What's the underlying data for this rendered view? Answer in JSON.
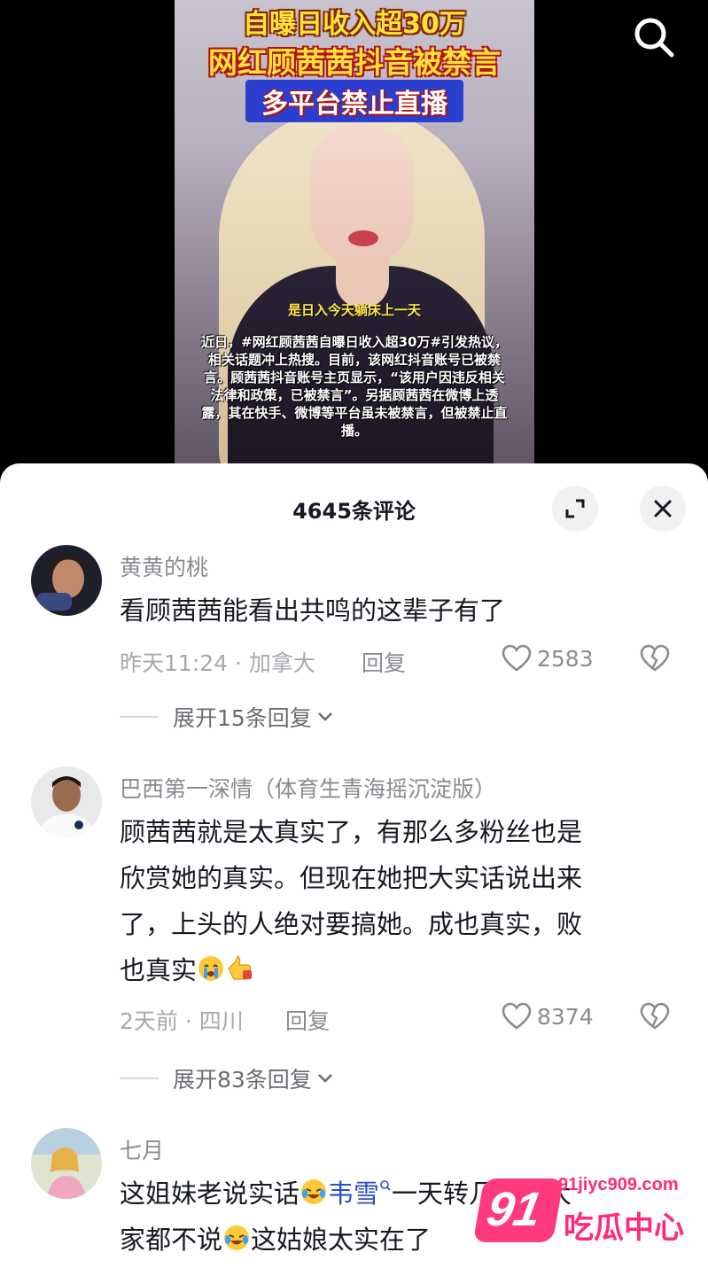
{
  "video": {
    "headline_1": "自曝日收入超30万",
    "headline_2": "网红顾茜茜抖音被禁言",
    "headline_3": "多平台禁止直播",
    "caption": "是日入今天躺床上一天",
    "news_text": "近日，#网红顾茜茜自曝日收入超30万#引发热议，相关话题冲上热搜。目前，该网红抖音账号已被禁言。顾茜茜抖音账号主页显示，“该用户因违反相关法律和政策，已被禁言”。另据顾茜茜在微博上透露，其在快手、微博等平台虽未被禁言，但被禁止直播。"
  },
  "comments_sheet": {
    "title": "4645条评论"
  },
  "comments": [
    {
      "user": "黄黄的桃",
      "text": "看顾茜茜能看出共鸣的这辈子有了",
      "meta": "昨天11:24 · 加拿大",
      "reply_label": "回复",
      "likes": "2583",
      "expand_label": "展开15条回复"
    },
    {
      "user": "巴西第一深情（体育生青海摇沉淀版）",
      "text_line_1": "顾茜茜就是太真实了，有那么多粉丝也是",
      "text_line_2": "欣赏她的真实。但现在她把大实话说出来",
      "text_line_3": "了，上头的人绝对要搞她。成也真实，败",
      "text_line_4": "也真实",
      "meta": "2天前 · 四川",
      "reply_label": "回复",
      "likes": "8374",
      "expand_label": "展开83条回复"
    },
    {
      "user": "七月",
      "text_a": "这姐妹老说实话",
      "mention": "韦雪",
      "text_b": "一天转几百万大",
      "text_c": "家都不说",
      "text_d": "这姑娘太实在了"
    }
  ],
  "watermark": {
    "domain": "91jiyc909.com",
    "logo_number": "91",
    "logo_text": "吃瓜中心"
  }
}
